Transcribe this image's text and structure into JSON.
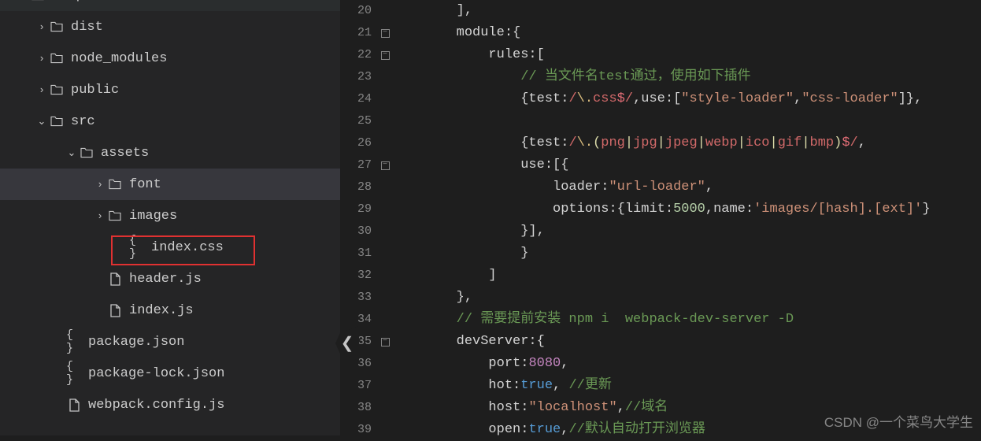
{
  "sidebar": {
    "items": [
      {
        "label": "webpack",
        "type": "folder",
        "open": true,
        "indent": 0
      },
      {
        "label": "dist",
        "type": "folder",
        "open": false,
        "indent": 1
      },
      {
        "label": "node_modules",
        "type": "folder",
        "open": false,
        "indent": 1
      },
      {
        "label": "public",
        "type": "folder",
        "open": false,
        "indent": 1
      },
      {
        "label": "src",
        "type": "folder",
        "open": true,
        "indent": 1
      },
      {
        "label": "assets",
        "type": "folder",
        "open": true,
        "indent": 3
      },
      {
        "label": "font",
        "type": "folder",
        "open": false,
        "indent": 4
      },
      {
        "label": "images",
        "type": "folder",
        "open": false,
        "indent": 4
      },
      {
        "label": "index.css",
        "type": "css",
        "indent": 5,
        "highlighted": true
      },
      {
        "label": "header.js",
        "type": "js",
        "indent": 4,
        "fileicon": "js"
      },
      {
        "label": "index.js",
        "type": "js",
        "indent": 4,
        "fileicon": "js"
      },
      {
        "label": "package.json",
        "type": "json",
        "indent": 2
      },
      {
        "label": "package-lock.json",
        "type": "json",
        "indent": 2
      },
      {
        "label": "webpack.config.js",
        "type": "js",
        "indent": 2,
        "fileicon": "js"
      }
    ]
  },
  "editor": {
    "lines": [
      {
        "n": 20,
        "fold": "",
        "segs": [
          {
            "t": "        ],",
            "c": "tok-default"
          }
        ]
      },
      {
        "n": 21,
        "fold": "minus",
        "segs": [
          {
            "t": "        module:{",
            "c": "tok-default"
          }
        ]
      },
      {
        "n": 22,
        "fold": "minus",
        "segs": [
          {
            "t": "            rules:[",
            "c": "tok-default"
          }
        ]
      },
      {
        "n": 23,
        "fold": "",
        "segs": [
          {
            "t": "                ",
            "c": "tok-default"
          },
          {
            "t": "// 当文件名test通过，使用如下插件",
            "c": "tok-comment"
          }
        ]
      },
      {
        "n": 24,
        "fold": "",
        "segs": [
          {
            "t": "                {test:",
            "c": "tok-default"
          },
          {
            "t": "/",
            "c": "tok-regex"
          },
          {
            "t": "\\.",
            "c": "tok-regex-esc"
          },
          {
            "t": "css",
            "c": "tok-regex"
          },
          {
            "t": "$",
            "c": "tok-regex-end"
          },
          {
            "t": "/",
            "c": "tok-regex"
          },
          {
            "t": ",use:[",
            "c": "tok-default"
          },
          {
            "t": "\"style-loader\"",
            "c": "tok-str"
          },
          {
            "t": ",",
            "c": "tok-default"
          },
          {
            "t": "\"css-loader\"",
            "c": "tok-str"
          },
          {
            "t": "]},",
            "c": "tok-default"
          }
        ]
      },
      {
        "n": 25,
        "fold": "",
        "segs": [
          {
            "t": "",
            "c": "tok-default"
          }
        ]
      },
      {
        "n": 26,
        "fold": "",
        "segs": [
          {
            "t": "                {test:",
            "c": "tok-default"
          },
          {
            "t": "/",
            "c": "tok-regex"
          },
          {
            "t": "\\.",
            "c": "tok-regex-esc"
          },
          {
            "t": "(",
            "c": "tok-regex-grp"
          },
          {
            "t": "png",
            "c": "tok-regex"
          },
          {
            "t": "|",
            "c": "tok-regex-grp"
          },
          {
            "t": "jpg",
            "c": "tok-regex"
          },
          {
            "t": "|",
            "c": "tok-regex-grp"
          },
          {
            "t": "jpeg",
            "c": "tok-regex"
          },
          {
            "t": "|",
            "c": "tok-regex-grp"
          },
          {
            "t": "webp",
            "c": "tok-regex"
          },
          {
            "t": "|",
            "c": "tok-regex-grp"
          },
          {
            "t": "ico",
            "c": "tok-regex"
          },
          {
            "t": "|",
            "c": "tok-regex-grp"
          },
          {
            "t": "gif",
            "c": "tok-regex"
          },
          {
            "t": "|",
            "c": "tok-regex-grp"
          },
          {
            "t": "bmp",
            "c": "tok-regex"
          },
          {
            "t": ")",
            "c": "tok-regex-grp"
          },
          {
            "t": "$",
            "c": "tok-regex-end"
          },
          {
            "t": "/",
            "c": "tok-regex"
          },
          {
            "t": ",",
            "c": "tok-default"
          }
        ]
      },
      {
        "n": 27,
        "fold": "minus",
        "segs": [
          {
            "t": "                use:[{",
            "c": "tok-default"
          }
        ]
      },
      {
        "n": 28,
        "fold": "",
        "segs": [
          {
            "t": "                    loader:",
            "c": "tok-default"
          },
          {
            "t": "\"url-loader\"",
            "c": "tok-str"
          },
          {
            "t": ",",
            "c": "tok-default"
          }
        ]
      },
      {
        "n": 29,
        "fold": "",
        "segs": [
          {
            "t": "                    options:{limit:",
            "c": "tok-default"
          },
          {
            "t": "5000",
            "c": "tok-num"
          },
          {
            "t": ",name:",
            "c": "tok-default"
          },
          {
            "t": "'images/[hash].[ext]'",
            "c": "tok-str"
          },
          {
            "t": "}",
            "c": "tok-default"
          }
        ]
      },
      {
        "n": 30,
        "fold": "",
        "segs": [
          {
            "t": "                }],",
            "c": "tok-default"
          }
        ]
      },
      {
        "n": 31,
        "fold": "",
        "segs": [
          {
            "t": "                }",
            "c": "tok-default"
          }
        ]
      },
      {
        "n": 32,
        "fold": "",
        "segs": [
          {
            "t": "            ]",
            "c": "tok-default"
          }
        ]
      },
      {
        "n": 33,
        "fold": "",
        "segs": [
          {
            "t": "        },",
            "c": "tok-default"
          }
        ]
      },
      {
        "n": 34,
        "fold": "",
        "segs": [
          {
            "t": "        ",
            "c": "tok-default"
          },
          {
            "t": "// 需要提前安装 npm i  webpack-dev-server -D",
            "c": "tok-comment"
          }
        ]
      },
      {
        "n": 35,
        "fold": "minus",
        "segs": [
          {
            "t": "        devServer:{",
            "c": "tok-default"
          }
        ]
      },
      {
        "n": 36,
        "fold": "",
        "segs": [
          {
            "t": "            port:",
            "c": "tok-default"
          },
          {
            "t": "8080",
            "c": "tok-port"
          },
          {
            "t": ",",
            "c": "tok-default"
          }
        ]
      },
      {
        "n": 37,
        "fold": "",
        "segs": [
          {
            "t": "            hot:",
            "c": "tok-default"
          },
          {
            "t": "true",
            "c": "tok-bool"
          },
          {
            "t": ", ",
            "c": "tok-default"
          },
          {
            "t": "//更新",
            "c": "tok-comment"
          }
        ]
      },
      {
        "n": 38,
        "fold": "",
        "segs": [
          {
            "t": "            host:",
            "c": "tok-default"
          },
          {
            "t": "\"localhost\"",
            "c": "tok-str"
          },
          {
            "t": ",",
            "c": "tok-default"
          },
          {
            "t": "//域名",
            "c": "tok-comment"
          }
        ]
      },
      {
        "n": 39,
        "fold": "",
        "segs": [
          {
            "t": "            open:",
            "c": "tok-default"
          },
          {
            "t": "true",
            "c": "tok-bool"
          },
          {
            "t": ",",
            "c": "tok-default"
          },
          {
            "t": "//默认自动打开浏览器",
            "c": "tok-comment"
          }
        ]
      }
    ]
  },
  "watermark": "CSDN @一个菜鸟大学生"
}
